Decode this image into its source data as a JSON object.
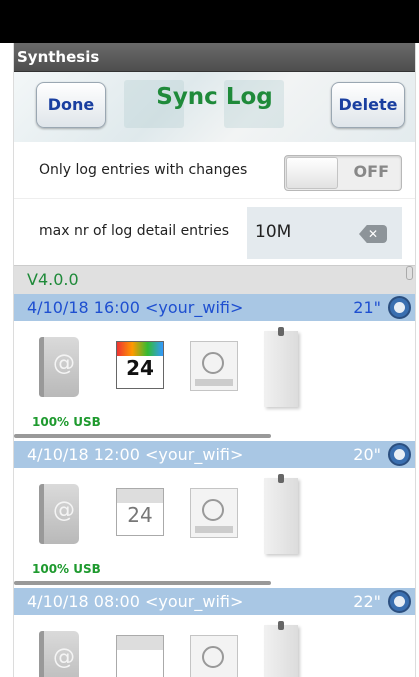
{
  "window": {
    "title": "Synthesis"
  },
  "header": {
    "done_label": "Done",
    "title": "Sync Log",
    "delete_label": "Delete"
  },
  "settings": {
    "only_changes": {
      "label": "Only log entries with changes",
      "toggle_state": "OFF"
    },
    "max_entries": {
      "label": "max nr of log detail entries",
      "value": "10M"
    }
  },
  "version": "V4.0.0",
  "entries": [
    {
      "date": "4/10/18",
      "time": "16:00",
      "network": "<your_wifi>",
      "duration": "21\"",
      "contacts_status": "100% USB",
      "calendar_day": "24"
    },
    {
      "date": "4/10/18",
      "time": "12:00",
      "network": "<your_wifi>",
      "duration": "20\"",
      "contacts_status": "100% USB",
      "calendar_day": "24"
    },
    {
      "date": "4/10/18",
      "time": "08:00",
      "network": "<your_wifi>",
      "duration": "22\""
    }
  ],
  "colors": {
    "accent_green": "#1f8a3a",
    "button_text": "#1a3fa0",
    "entry_header_bg": "#a9c7e4",
    "status_green": "#1e9a2e"
  }
}
